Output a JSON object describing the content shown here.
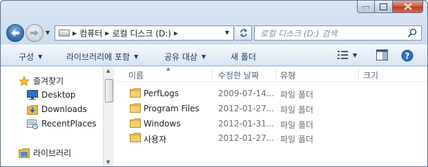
{
  "address": {
    "crumbs": [
      "컴퓨터",
      "로컬 디스크 (D:)"
    ]
  },
  "search": {
    "placeholder": "로컬 디스크 (D:) 검색"
  },
  "toolbar": {
    "organize": "구성",
    "include_library": "라이브러리에 포함",
    "share_with": "공유 대상",
    "new_folder": "새 폴더"
  },
  "nav": {
    "favorites_label": "즐겨찾기",
    "favorites": [
      {
        "label": "Desktop",
        "icon": "desktop-icon"
      },
      {
        "label": "Downloads",
        "icon": "downloads-icon"
      },
      {
        "label": "RecentPlaces",
        "icon": "recent-places-icon"
      }
    ],
    "libraries_label": "라이브러리"
  },
  "columns": {
    "name": "이름",
    "date": "수정한 날짜",
    "type": "유형",
    "size": "크기"
  },
  "files": [
    {
      "name": "PerfLogs",
      "date": "2009-07-14...",
      "type": "파일 폴더"
    },
    {
      "name": "Program Files",
      "date": "2012-01-27...",
      "type": "파일 폴더"
    },
    {
      "name": "Windows",
      "date": "2012-01-31...",
      "type": "파일 폴더"
    },
    {
      "name": "사용자",
      "date": "2012-01-27...",
      "type": "파일 폴더"
    }
  ],
  "colors": {
    "folder": "#e8b94a",
    "accent": "#2c6bb6",
    "close": "#c03b1f"
  }
}
